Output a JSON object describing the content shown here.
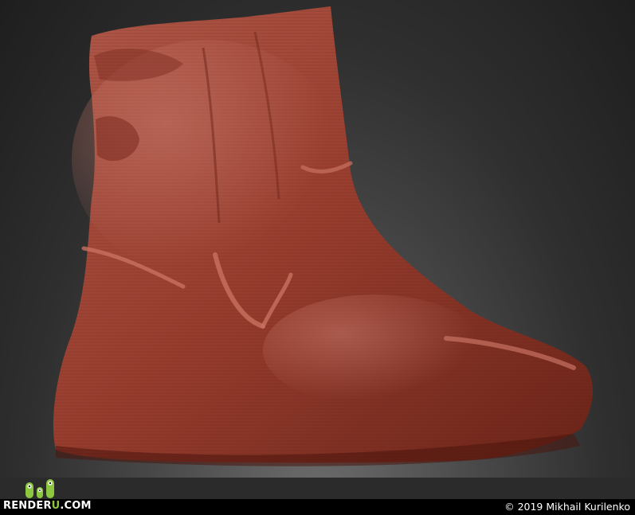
{
  "branding": {
    "logo_prefix": "RENDER",
    "logo_accent": "U",
    "logo_suffix": ".COM",
    "accent_color": "#8dc63f"
  },
  "footer": {
    "copyright": "© 2019 Mikhail Kurilenko"
  },
  "image": {
    "subject": "sculpted-foot",
    "material_color": "#9a3f30"
  }
}
